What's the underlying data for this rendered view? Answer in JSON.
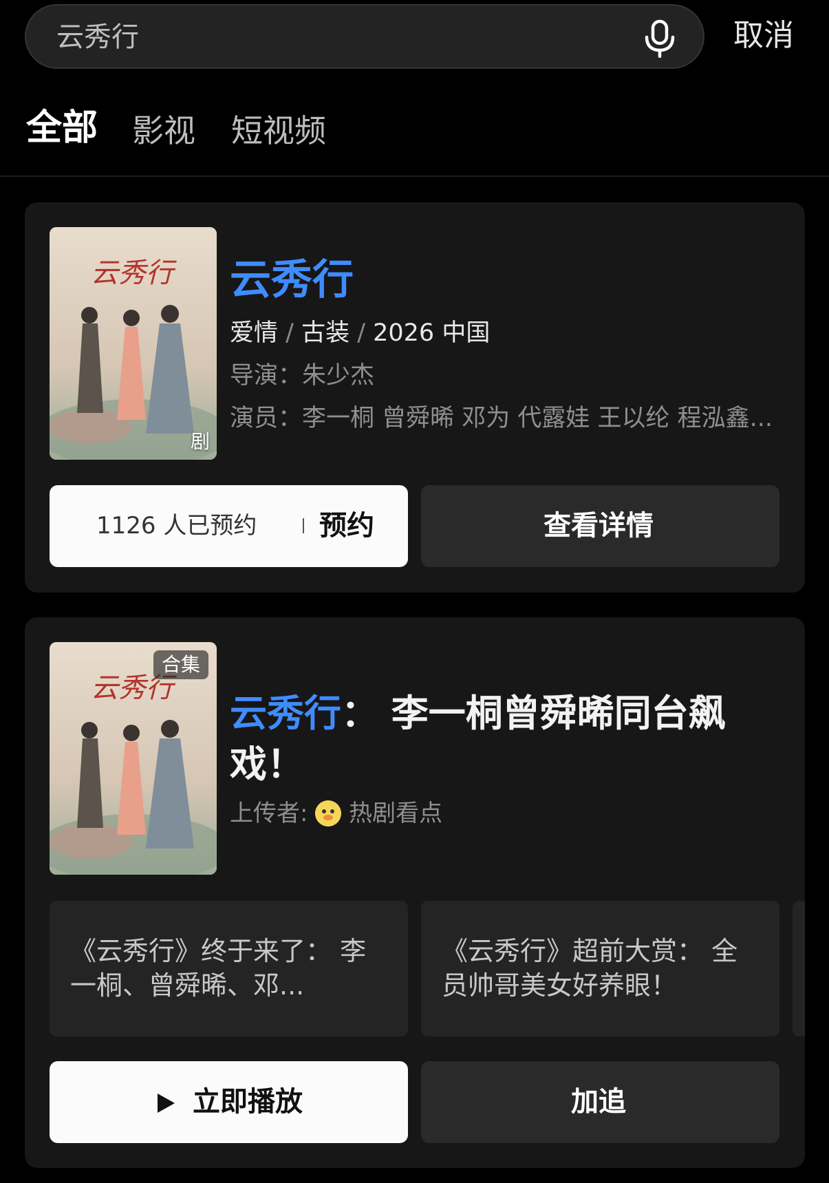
{
  "search": {
    "query": "云秀行",
    "mic_icon": "microphone-icon",
    "cancel_label": "取消"
  },
  "tabs": [
    {
      "label": "全部",
      "active": true
    },
    {
      "label": "影视",
      "active": false
    },
    {
      "label": "短视频",
      "active": false
    }
  ],
  "drama_card": {
    "poster_badge": "剧",
    "title": "云秀行",
    "genre1": "爱情",
    "genre2": "古装",
    "year_region": "2026 中国",
    "director_label": "导演：",
    "director": "朱少杰",
    "cast_label": "演员：",
    "cast": "李一桐 曾舜晞 邓为 代露娃 王以纶 程泓鑫...",
    "reserve_count": "1126 人已预约",
    "reserve_label": "预约",
    "details_label": "查看详情"
  },
  "collection_card": {
    "poster_badge": "合集",
    "title_highlight": "云秀行",
    "title_rest": "： 李一桐曾舜晞同台飙戏！",
    "uploader_label": "上传者:",
    "uploader_avatar": "duck-avatar-icon",
    "uploader_name": "热剧看点",
    "recommendations": [
      "《云秀行》终于来了： 李一桐、曾舜晞、邓...",
      "《云秀行》超前大赏： 全员帅哥美女好养眼！"
    ],
    "play_icon": "play-icon",
    "play_label": "立即播放",
    "follow_label": "加追"
  },
  "colors": {
    "accent": "#3f8cff",
    "background": "#000000",
    "card": "#171717"
  }
}
